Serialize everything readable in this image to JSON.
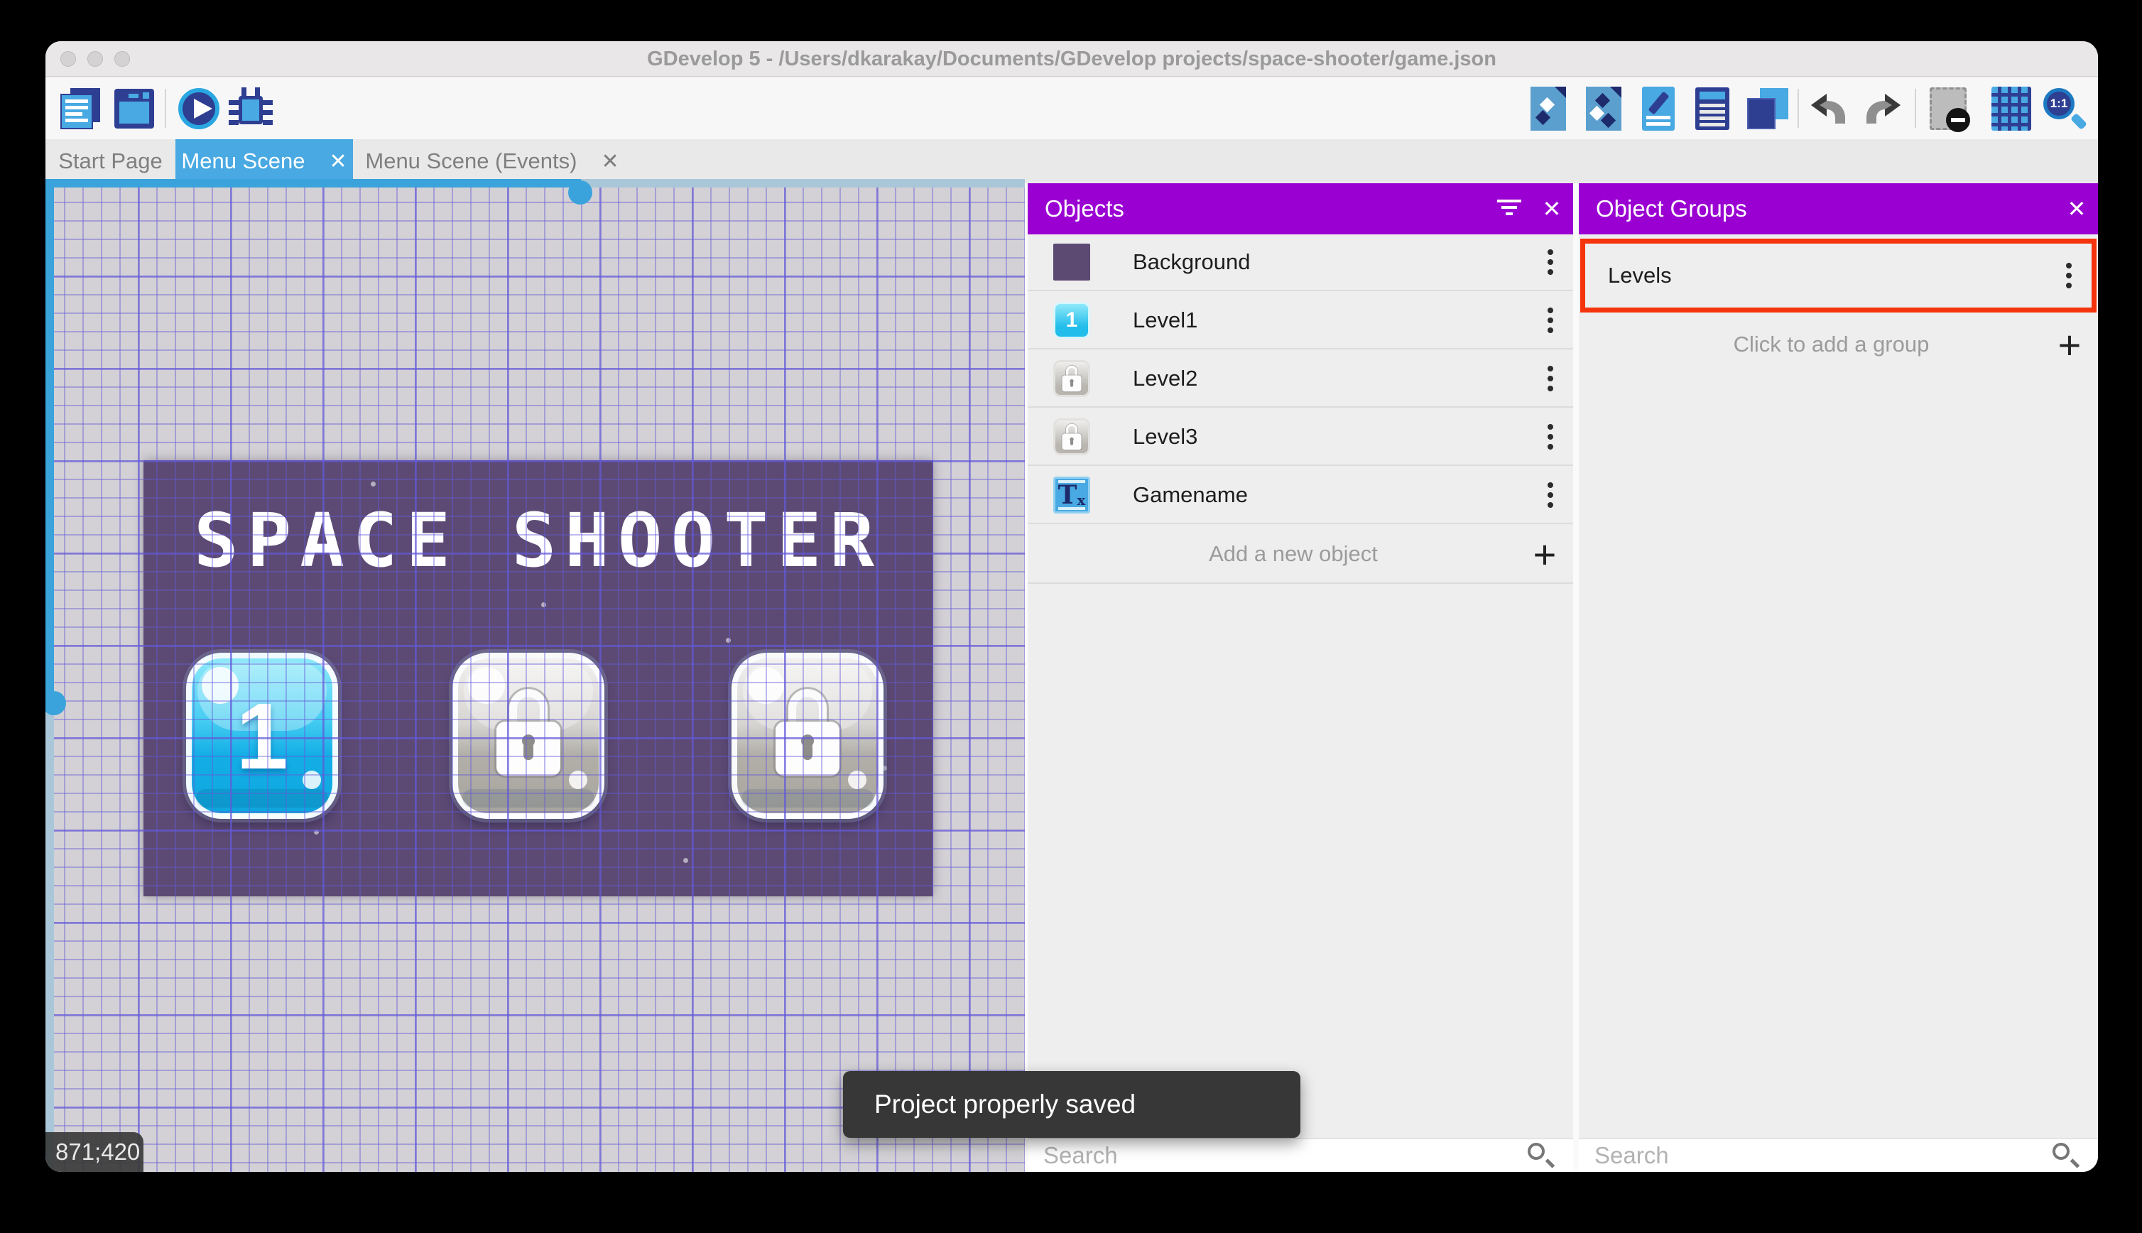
{
  "colors": {
    "header_purple": "#9a00d2",
    "accent_blue": "#49a9e2",
    "highlight_red": "#f5340e",
    "scene_purple": "#5c4a74",
    "toast_bg": "#373737"
  },
  "window": {
    "title": "GDevelop 5 - /Users/dkarakay/Documents/GDevelop projects/space-shooter/game.json"
  },
  "toolbar": {
    "left_icons": [
      "project-manager",
      "scene-editor-properties",
      "preview-play",
      "debug"
    ],
    "right_icons": [
      "objects-editor",
      "object-groups-editor",
      "properties",
      "instances-list",
      "layers",
      "undo",
      "redo",
      "toggle-mask",
      "toggle-grid",
      "zoom-1-1"
    ]
  },
  "tabs": [
    {
      "label": "Start Page",
      "active": false
    },
    {
      "label": "Menu Scene",
      "active": true
    },
    {
      "label": "Menu Scene (Events)",
      "active": false
    }
  ],
  "canvas": {
    "coordinates": "871;420",
    "scene_title": "SPACE SHOOTER",
    "level_buttons": [
      {
        "label": "1",
        "state": "unlocked"
      },
      {
        "label": "",
        "state": "locked"
      },
      {
        "label": "",
        "state": "locked"
      }
    ]
  },
  "objects_panel": {
    "title": "Objects",
    "items": [
      {
        "name": "Background"
      },
      {
        "name": "Level1"
      },
      {
        "name": "Level2"
      },
      {
        "name": "Level3"
      },
      {
        "name": "Gamename"
      }
    ],
    "add_label": "Add a new object",
    "search_placeholder": "Search"
  },
  "groups_panel": {
    "title": "Object Groups",
    "items": [
      {
        "name": "Levels",
        "highlighted": true
      }
    ],
    "add_label": "Click to add a group",
    "search_placeholder": "Search"
  },
  "toast": {
    "message": "Project properly saved"
  }
}
